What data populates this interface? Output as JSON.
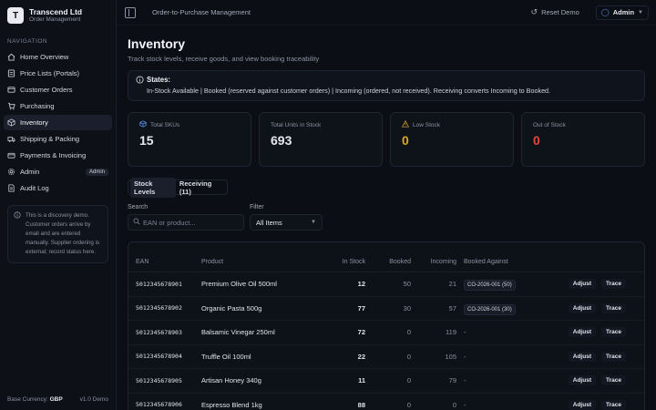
{
  "brand": {
    "logo_letter": "T",
    "name": "Transcend Ltd",
    "subtitle": "Order Management"
  },
  "sidebar": {
    "section_label": "NAVIGATION",
    "items": [
      {
        "label": "Home Overview",
        "icon": "home-icon"
      },
      {
        "label": "Price Lists (Portals)",
        "icon": "list-icon"
      },
      {
        "label": "Customer Orders",
        "icon": "orders-icon"
      },
      {
        "label": "Purchasing",
        "icon": "cart-icon"
      },
      {
        "label": "Inventory",
        "icon": "box-icon",
        "active": true
      },
      {
        "label": "Shipping & Packing",
        "icon": "truck-icon"
      },
      {
        "label": "Payments & Invoicing",
        "icon": "card-icon"
      },
      {
        "label": "Admin",
        "icon": "gear-icon",
        "badge": "Admin"
      },
      {
        "label": "Audit Log",
        "icon": "log-icon"
      }
    ],
    "info_text": "This is a discovery demo. Customer orders arrive by email and are entered manually. Supplier ordering is external; record status here.",
    "footer_label": "Base Currency:",
    "footer_currency": "GBP",
    "footer_version": "v1.0 Demo"
  },
  "topbar": {
    "breadcrumb": "Order-to-Purchase Management",
    "reset_label": "Reset Demo",
    "user_label": "Admin"
  },
  "page": {
    "title": "Inventory",
    "subtitle": "Track stock levels, receive goods, and view booking traceability"
  },
  "states": {
    "title": "States:",
    "text": "In-Stock Available | Booked (reserved against customer orders) | Incoming (ordered, not received). Receiving converts Incoming to Booked."
  },
  "stats": [
    {
      "label": "Total SKUs",
      "value": "15",
      "icon": "cube-icon",
      "color": "#f4f6fa",
      "icon_color": "#5b8def"
    },
    {
      "label": "Total Units in Stock",
      "value": "693",
      "icon": "",
      "color": "#f4f6fa",
      "icon_color": ""
    },
    {
      "label": "Low Stock",
      "value": "0",
      "icon": "warning-icon",
      "color": "#e0a51f",
      "icon_color": "#e0a51f"
    },
    {
      "label": "Out of Stock",
      "value": "0",
      "icon": "",
      "color": "#e0493c",
      "icon_color": ""
    }
  ],
  "tabs": [
    {
      "label": "Stock Levels",
      "active": true
    },
    {
      "label": "Receiving (11)",
      "active": false
    }
  ],
  "filters": {
    "search_label": "Search",
    "search_placeholder": "EAN or product...",
    "filter_label": "Filter",
    "filter_value": "All Items"
  },
  "table": {
    "headers": {
      "ean": "EAN",
      "product": "Product",
      "in_stock": "In Stock",
      "booked": "Booked",
      "incoming": "Incoming",
      "booked_against": "Booked Against"
    },
    "action_adjust": "Adjust",
    "action_trace": "Trace",
    "rows": [
      {
        "ean": "5012345678901",
        "product": "Premium Olive Oil 500ml",
        "in_stock": "12",
        "booked": "50",
        "incoming": "21",
        "booked_against": "CO-2026-001 (50)"
      },
      {
        "ean": "5012345678902",
        "product": "Organic Pasta 500g",
        "in_stock": "77",
        "booked": "30",
        "incoming": "57",
        "booked_against": "CO-2026-001 (30)"
      },
      {
        "ean": "5012345678903",
        "product": "Balsamic Vinegar 250ml",
        "in_stock": "72",
        "booked": "0",
        "incoming": "119",
        "booked_against": "-"
      },
      {
        "ean": "5012345678904",
        "product": "Truffle Oil 100ml",
        "in_stock": "22",
        "booked": "0",
        "incoming": "105",
        "booked_against": "-"
      },
      {
        "ean": "5012345678905",
        "product": "Artisan Honey 340g",
        "in_stock": "11",
        "booked": "0",
        "incoming": "79",
        "booked_against": "-"
      },
      {
        "ean": "5012345678906",
        "product": "Espresso Blend 1kg",
        "in_stock": "88",
        "booked": "0",
        "incoming": "0",
        "booked_against": "-"
      }
    ]
  }
}
